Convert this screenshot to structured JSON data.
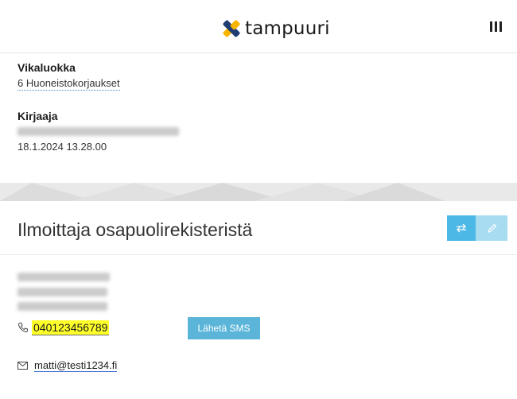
{
  "header": {
    "logo_text": "tampuuri",
    "logo_colors": {
      "yellow": "#f7b500",
      "blue": "#1f3c73"
    },
    "menu_icon": "menu-bars-icon"
  },
  "details": {
    "fault_class_label": "Vikaluokka",
    "fault_class_value": "6 Huoneistokorjaukset",
    "recorder_label": "Kirjaaja",
    "recorder_datetime": "18.1.2024 13.28.00"
  },
  "reporter": {
    "title": "Ilmoittaja osapuolirekisteristä",
    "swap_icon": "swap-arrows-icon",
    "edit_icon": "pencil-icon",
    "phone_icon": "phone-icon",
    "phone": "040123456789",
    "sms_button": "Lähetä SMS",
    "email_icon": "envelope-icon",
    "email": "matti@testi1234.fi"
  },
  "colors": {
    "accent": "#4bb8e6",
    "accent_light": "#a8dcf1",
    "highlight": "#ffff2a",
    "sms_button": "#5bb5d9"
  }
}
